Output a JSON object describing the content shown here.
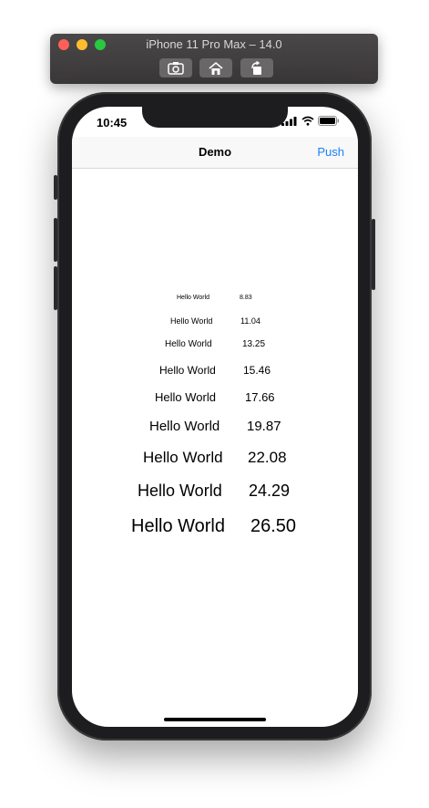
{
  "simulator": {
    "title": "iPhone 11 Pro Max – 14.0",
    "buttons": [
      "screenshot-icon",
      "home-icon",
      "rotate-icon"
    ]
  },
  "status_bar": {
    "time": "10:45"
  },
  "nav": {
    "title": "Demo",
    "push_label": "Push"
  },
  "rows": [
    {
      "label": "Hello World",
      "value": "8.83"
    },
    {
      "label": "Hello World",
      "value": "11.04"
    },
    {
      "label": "Hello World",
      "value": "13.25"
    },
    {
      "label": "Hello World",
      "value": "15.46"
    },
    {
      "label": "Hello World",
      "value": "17.66"
    },
    {
      "label": "Hello World",
      "value": "19.87"
    },
    {
      "label": "Hello World",
      "value": "22.08"
    },
    {
      "label": "Hello World",
      "value": "24.29"
    },
    {
      "label": "Hello World",
      "value": "26.50"
    }
  ]
}
